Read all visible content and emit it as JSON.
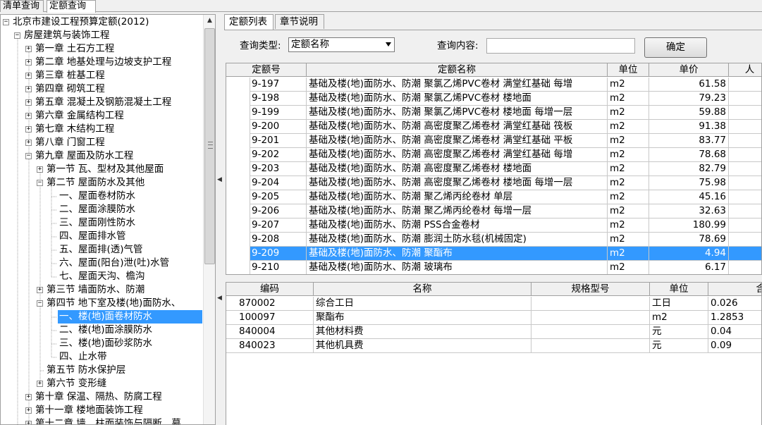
{
  "top_tabs": [
    "清单查询",
    "定额查询"
  ],
  "tree": {
    "root": "北京市建设工程预算定额(2012)",
    "level1": "房屋建筑与装饰工程",
    "chapters": [
      "第一章 土石方工程",
      "第二章 地基处理与边坡支护工程",
      "第三章 桩基工程",
      "第四章 砌筑工程",
      "第五章 混凝土及钢筋混凝土工程",
      "第六章 金属结构工程",
      "第七章 木结构工程",
      "第八章 门窗工程",
      "第九章 屋面及防水工程"
    ],
    "sec1": "第一节 瓦、型材及其他屋面",
    "sec2": "第二节 屋面防水及其他",
    "sec2_items": [
      "一、屋面卷材防水",
      "二、屋面涂膜防水",
      "三、屋面刚性防水",
      "四、屋面排水管",
      "五、屋面排(透)气管",
      "六、屋面(阳台)泄(吐)水管",
      "七、屋面天沟、檐沟"
    ],
    "sec3": "第三节 墙面防水、防潮",
    "sec4": "第四节 地下室及楼(地)面防水、",
    "sec4_items": [
      "一、楼(地)面卷材防水",
      "二、楼(地)面涂膜防水",
      "三、楼(地)面砂浆防水",
      "四、止水带"
    ],
    "sec5": "第五节 防水保护层",
    "sec6": "第六节 变形缝",
    "ch10": "第十章 保温、隔热、防腐工程",
    "ch11": "第十一章 楼地面装饰工程",
    "ch12": "第十二章 墙、柱面装饰与隔断、幕"
  },
  "right_tabs": [
    "定额列表",
    "章节说明"
  ],
  "query": {
    "type_label": "查询类型:",
    "type_value": "定额名称",
    "content_label": "查询内容:",
    "content_value": "",
    "ok_label": "确定"
  },
  "upper_grid": {
    "headers": [
      "定额号",
      "定额名称",
      "单位",
      "单价",
      "人"
    ],
    "rows": [
      {
        "code": "9-197",
        "name": "基础及楼(地)面防水、防潮 聚氯乙烯PVC卷材 满堂红基础 每增",
        "unit": "m2",
        "price": "61.58"
      },
      {
        "code": "9-198",
        "name": "基础及楼(地)面防水、防潮 聚氯乙烯PVC卷材 楼地面",
        "unit": "m2",
        "price": "79.23"
      },
      {
        "code": "9-199",
        "name": "基础及楼(地)面防水、防潮 聚氯乙烯PVC卷材 楼地面 每增一层",
        "unit": "m2",
        "price": "59.88"
      },
      {
        "code": "9-200",
        "name": "基础及楼(地)面防水、防潮 高密度聚乙烯卷材 满堂红基础 筏板",
        "unit": "m2",
        "price": "91.38"
      },
      {
        "code": "9-201",
        "name": "基础及楼(地)面防水、防潮 高密度聚乙烯卷材 满堂红基础 平板",
        "unit": "m2",
        "price": "83.77"
      },
      {
        "code": "9-202",
        "name": "基础及楼(地)面防水、防潮 高密度聚乙烯卷材 满堂红基础 每增",
        "unit": "m2",
        "price": "78.68"
      },
      {
        "code": "9-203",
        "name": "基础及楼(地)面防水、防潮 高密度聚乙烯卷材 楼地面",
        "unit": "m2",
        "price": "82.79"
      },
      {
        "code": "9-204",
        "name": "基础及楼(地)面防水、防潮 高密度聚乙烯卷材 楼地面 每增一层",
        "unit": "m2",
        "price": "75.98"
      },
      {
        "code": "9-205",
        "name": "基础及楼(地)面防水、防潮 聚乙烯丙纶卷材 单层",
        "unit": "m2",
        "price": "45.16"
      },
      {
        "code": "9-206",
        "name": "基础及楼(地)面防水、防潮 聚乙烯丙纶卷材 每增一层",
        "unit": "m2",
        "price": "32.63"
      },
      {
        "code": "9-207",
        "name": "基础及楼(地)面防水、防潮 PSS合金卷材",
        "unit": "m2",
        "price": "180.99"
      },
      {
        "code": "9-208",
        "name": "基础及楼(地)面防水、防潮 膨润土防水毯(机械固定)",
        "unit": "m2",
        "price": "78.69"
      },
      {
        "code": "9-209",
        "name": "基础及楼(地)面防水、防潮 聚酯布",
        "unit": "m2",
        "price": "4.94"
      },
      {
        "code": "9-210",
        "name": "基础及楼(地)面防水、防潮 玻璃布",
        "unit": "m2",
        "price": "6.17"
      }
    ]
  },
  "lower_grid": {
    "headers": [
      "编码",
      "名称",
      "规格型号",
      "单位",
      "含"
    ],
    "rows": [
      {
        "code": "870002",
        "name": "综合工日",
        "spec": "",
        "unit": "工日",
        "qty": "0.026"
      },
      {
        "code": "100097",
        "name": "聚酯布",
        "spec": "",
        "unit": "m2",
        "qty": "1.2853"
      },
      {
        "code": "840004",
        "name": "其他材料费",
        "spec": "",
        "unit": "元",
        "qty": "0.04"
      },
      {
        "code": "840023",
        "name": "其他机具费",
        "spec": "",
        "unit": "元",
        "qty": "0.09"
      }
    ]
  },
  "colors": {
    "selection": "#3399ff",
    "panel_bg": "#f0f0f0",
    "border": "#a0a0a0"
  }
}
